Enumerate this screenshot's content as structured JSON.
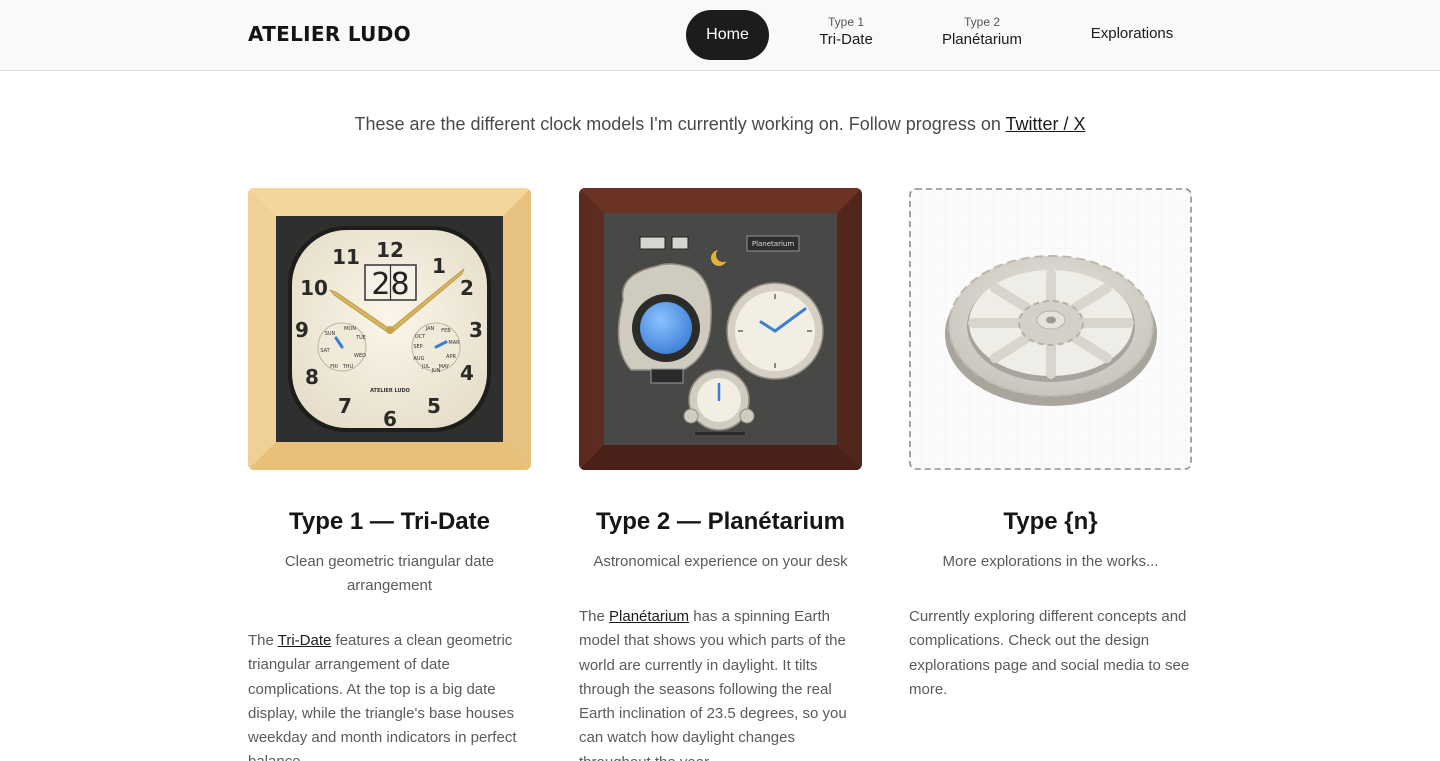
{
  "header": {
    "brand": "ATELIER LUDO",
    "nav": {
      "home": "Home",
      "type1_sub": "Type 1",
      "type1_main": "Tri-Date",
      "type2_sub": "Type 2",
      "type2_main": "Planétarium",
      "explorations": "Explorations"
    }
  },
  "intro": {
    "text": "These are the different clock models I'm currently working on. Follow progress on ",
    "link": "Twitter / X"
  },
  "cards": [
    {
      "title": "Type 1 — Tri-Date",
      "subtitle": "Clean geometric triangular date arrangement",
      "body_pre": "The ",
      "body_link": "Tri-Date",
      "body_post": " features a clean geometric triangular arrangement of date complications. At the top is a big date display, while the triangle's base houses weekday and month indicators in perfect balance.",
      "image": {
        "date_display": "28",
        "numerals": [
          "12",
          "1",
          "2",
          "3",
          "4",
          "5",
          "6",
          "7",
          "8",
          "9",
          "10",
          "11"
        ],
        "weekday_labels": [
          "MON",
          "TUE",
          "WED",
          "THU",
          "FRI",
          "SAT",
          "SUN"
        ],
        "month_labels": [
          "JAN",
          "FEB",
          "MAR",
          "APR",
          "MAY",
          "JUN",
          "JUL",
          "AUG",
          "SEP",
          "OCT",
          "NOV",
          "DEC"
        ],
        "maker_mark": "ATELIER LUDO"
      }
    },
    {
      "title": "Type 2 — Planétarium",
      "subtitle": "Astronomical experience on your desk",
      "body_pre": "The ",
      "body_link": "Planétarium",
      "body_post": " has a spinning Earth model that shows you which parts of the world are currently in daylight. It tilts through the seasons following the real Earth inclination of 23.5 degrees, so you can watch how daylight changes throughout the year.",
      "image": {
        "plaque": "Planetarium"
      }
    },
    {
      "title": "Type {n}",
      "subtitle": "More explorations in the works...",
      "body_pre": "Currently exploring different concepts and complications. Check out the design explorations page and social media to see more.",
      "body_link": "",
      "body_post": ""
    }
  ],
  "colors": {
    "accent_dark": "#1c1c1c",
    "text_muted": "#5a5a5a",
    "wood_light": "#f0d49a",
    "wood_dark": "#5b2a1f",
    "earth_blue": "#4f93e6",
    "hand_blue": "#3a7fd5",
    "hand_gold": "#d8b45a"
  }
}
